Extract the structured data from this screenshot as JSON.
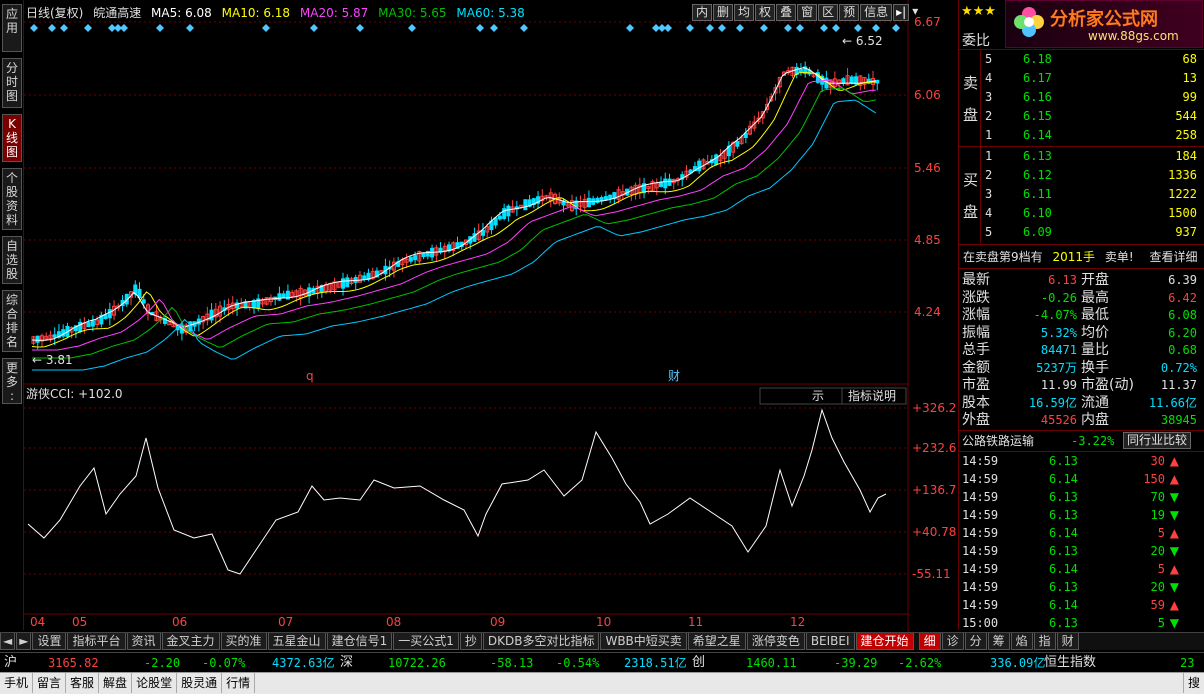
{
  "left_sidebar": [
    {
      "label": "应\n用"
    },
    {
      "label": "分\n时\n图"
    },
    {
      "label": "K\n线\n图",
      "active": true
    },
    {
      "label": "个\n股\n资\n料"
    },
    {
      "label": "自\n选\n股"
    },
    {
      "label": "综\n合\n排\n名"
    },
    {
      "label": "更\n多\n:"
    }
  ],
  "chart_header": {
    "period": "日线(复权)",
    "stock_name": "皖通高速",
    "ma5": "MA5: 6.08",
    "ma10": "MA10: 6.18",
    "ma20": "MA20: 5.87",
    "ma30": "MA30: 5.65",
    "ma60": "MA60: 5.38"
  },
  "toolbar": [
    "内",
    "删",
    "均",
    "权",
    "叠",
    "窗",
    "区",
    "预",
    "信息"
  ],
  "price_axis": [
    "6.67",
    "6.06",
    "5.46",
    "4.85",
    "4.24"
  ],
  "price_annotations": {
    "high": "6.52",
    "low": "3.81",
    "marker_q": "q",
    "marker_cai": "财"
  },
  "cci_header": {
    "label": "游侠CCI: +102.0",
    "btn_shi": "示",
    "btn_help": "指标说明"
  },
  "cci_axis": [
    "+326.2",
    "+232.6",
    "+136.7",
    "+40.78",
    "-55.11"
  ],
  "month_axis": [
    "04",
    "05",
    "06",
    "07",
    "08",
    "09",
    "10",
    "11",
    "12"
  ],
  "logo": {
    "text": "分析家公式网",
    "url": "www.88gs.com",
    "stars": "★★★"
  },
  "order_book": {
    "title": "委比",
    "sell_label": [
      "卖",
      "盘"
    ],
    "buy_label": [
      "买",
      "盘"
    ],
    "sell": [
      {
        "lvl": "5",
        "price": "6.18",
        "vol": "68"
      },
      {
        "lvl": "4",
        "price": "6.17",
        "vol": "13"
      },
      {
        "lvl": "3",
        "price": "6.16",
        "vol": "99"
      },
      {
        "lvl": "2",
        "price": "6.15",
        "vol": "544"
      },
      {
        "lvl": "1",
        "price": "6.14",
        "vol": "258"
      }
    ],
    "buy": [
      {
        "lvl": "1",
        "price": "6.13",
        "vol": "184"
      },
      {
        "lvl": "2",
        "price": "6.12",
        "vol": "1336"
      },
      {
        "lvl": "3",
        "price": "6.11",
        "vol": "1222"
      },
      {
        "lvl": "4",
        "price": "6.10",
        "vol": "1500"
      },
      {
        "lvl": "5",
        "price": "6.09",
        "vol": "937"
      }
    ],
    "notice": {
      "text": "在卖盘第9档有",
      "qty": "2011手",
      "suffix": "卖单!",
      "link": "查看详细"
    }
  },
  "quote": [
    {
      "k1": "最新",
      "v1": "6.13",
      "c1": "up",
      "k2": "开盘",
      "v2": "6.39",
      "c2": "wh"
    },
    {
      "k1": "涨跌",
      "v1": "-0.26",
      "c1": "dn",
      "k2": "最高",
      "v2": "6.42",
      "c2": "up"
    },
    {
      "k1": "涨幅",
      "v1": "-4.07%",
      "c1": "dn",
      "k2": "最低",
      "v2": "6.08",
      "c2": "dn"
    },
    {
      "k1": "振幅",
      "v1": "5.32%",
      "c1": "cy",
      "k2": "均价",
      "v2": "6.20",
      "c2": "dn"
    },
    {
      "k1": "总手",
      "v1": "84471",
      "c1": "cy",
      "k2": "量比",
      "v2": "0.68",
      "c2": "dn"
    },
    {
      "k1": "金额",
      "v1": "5237万",
      "c1": "cy",
      "k2": "换手",
      "v2": "0.72%",
      "c2": "cy"
    },
    {
      "k1": "市盈",
      "v1": "11.99",
      "c1": "wh",
      "k2": "市盈(动)",
      "v2": "11.37",
      "c2": "wh"
    },
    {
      "k1": "股本",
      "v1": "16.59亿",
      "c1": "cy",
      "k2": "流通",
      "v2": "11.66亿",
      "c2": "cy"
    },
    {
      "k1": "外盘",
      "v1": "45526",
      "c1": "up",
      "k2": "内盘",
      "v2": "38945",
      "c2": "dn"
    }
  ],
  "industry": {
    "name": "公路铁路运输",
    "change": "-3.22%",
    "btn": "同行业比较"
  },
  "ticks": [
    {
      "time": "14:59",
      "price": "6.13",
      "vol": "30",
      "dir": "up"
    },
    {
      "time": "14:59",
      "price": "6.14",
      "vol": "150",
      "dir": "up"
    },
    {
      "time": "14:59",
      "price": "6.13",
      "vol": "70",
      "dir": "dn"
    },
    {
      "time": "14:59",
      "price": "6.13",
      "vol": "19",
      "dir": "dn"
    },
    {
      "time": "14:59",
      "price": "6.14",
      "vol": "5",
      "dir": "up"
    },
    {
      "time": "14:59",
      "price": "6.13",
      "vol": "20",
      "dir": "dn"
    },
    {
      "time": "14:59",
      "price": "6.14",
      "vol": "5",
      "dir": "up"
    },
    {
      "time": "14:59",
      "price": "6.13",
      "vol": "20",
      "dir": "dn"
    },
    {
      "time": "14:59",
      "price": "6.14",
      "vol": "59",
      "dir": "up"
    },
    {
      "time": "15:00",
      "price": "6.13",
      "vol": "5",
      "dir": "dn"
    }
  ],
  "bottom_tabs": [
    "设置",
    "指标平台",
    "资讯",
    "金叉主力",
    "买的准",
    "五星金山",
    "建仓信号1",
    "一买公式1",
    "抄",
    "DKDB多空对比指标",
    "WBB中短买卖",
    "希望之星",
    "涨停变色",
    "BEIBEI",
    "建仓开始"
  ],
  "right_tabs": [
    "细",
    "诊",
    "分",
    "筹",
    "焰",
    "指",
    "财"
  ],
  "index_bar": {
    "sh_label": "沪",
    "sh_val": "3165.82",
    "sh_chg": "-2.20",
    "sh_pct": "-0.07%",
    "sh_amt": "4372.63亿",
    "sz_label": "深",
    "sz_val": "10722.26",
    "sz_chg": "-58.13",
    "sz_pct": "-0.54%",
    "sz_amt": "2318.51亿",
    "cy_label": "创",
    "cy_val": "1460.11",
    "cy_chg": "-39.29",
    "cy_pct": "-2.62%",
    "cy_amt": "336.09亿",
    "hs_label": "恒生指数",
    "hs_val": "23"
  },
  "menu": [
    "手机",
    "留言",
    "客服",
    "解盘",
    "论股堂",
    "股灵通",
    "行情"
  ],
  "menu_right": "搜",
  "colors": {
    "up": "#ff4040",
    "down": "#00e0ff",
    "ma5": "#ffffff",
    "ma10": "#ffff00",
    "ma20": "#ff40ff",
    "ma30": "#00c000",
    "ma60": "#00c8ff",
    "grid": "#6b0000"
  }
}
